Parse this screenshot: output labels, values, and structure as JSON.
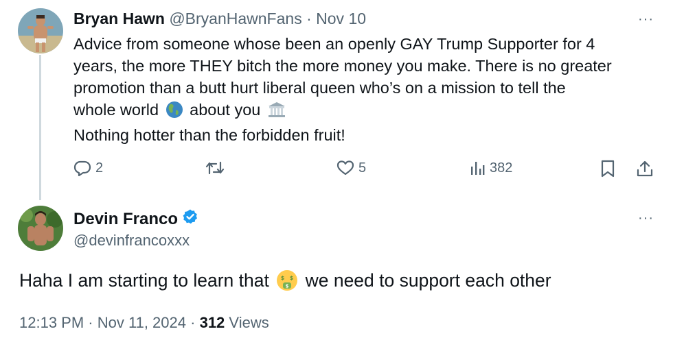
{
  "reply_tweet": {
    "author_name": "Bryan Hawn",
    "handle": "@BryanHawnFans",
    "separator": "·",
    "date": "Nov 10",
    "text_line1": "Advice from someone whose been an openly GAY Trump Supporter for 4",
    "text_line2": "years, the more THEY bitch the more money you make. There is no greater",
    "text_line3": "promotion than a butt hurt liberal queen who’s on a mission to tell the",
    "text_line4a": "whole world",
    "text_line4b": "about you",
    "text_line5": "Nothing hotter than the forbidden fruit!",
    "emoji_icons": [
      "globe-americas-icon",
      "classical-building-icon"
    ],
    "more_label": "···",
    "actions": {
      "reply_count": "2",
      "retweet_count": "",
      "like_count": "5",
      "views_count": "382"
    }
  },
  "main_tweet": {
    "author_name": "Devin Franco",
    "handle": "@devinfrancoxxx",
    "verified": true,
    "more_label": "···",
    "text_before_emoji": "Haha I am starting to learn that",
    "text_after_emoji": "we need to support each other",
    "emoji_icon": "money-mouth-face-icon",
    "time": "12:13 PM",
    "sep1": "·",
    "date": "Nov 11, 2024",
    "sep2": "·",
    "views_count": "312",
    "views_label": "Views"
  },
  "colors": {
    "text": "#0f1419",
    "secondary": "#536471",
    "verified_blue": "#1d9bf0",
    "thread_line": "#cfd9de"
  }
}
